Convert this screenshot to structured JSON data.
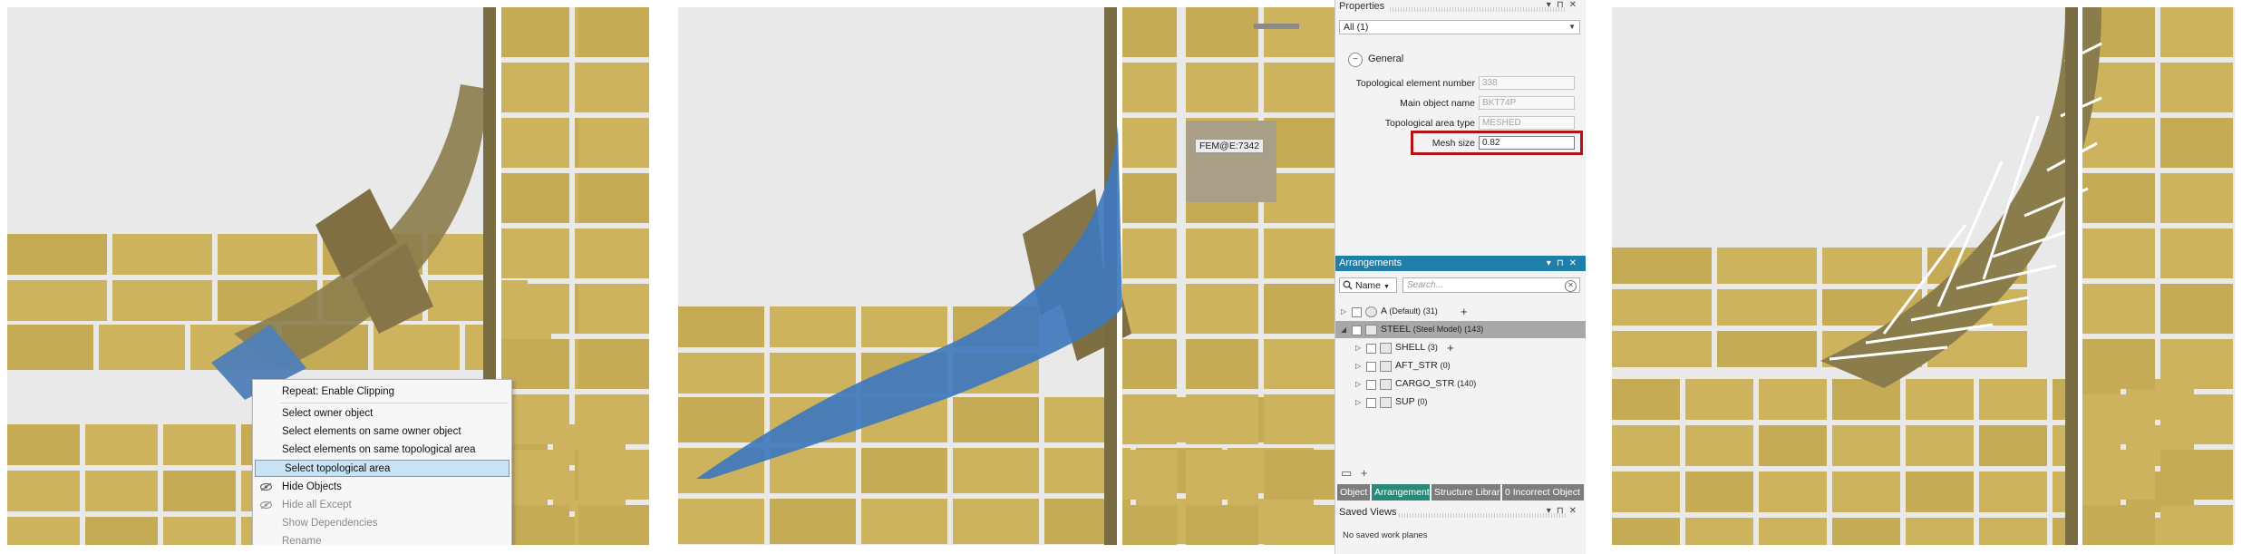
{
  "context_menu": {
    "items": [
      {
        "label": "Repeat: Enable Clipping",
        "state": "normal"
      },
      {
        "label": "Select owner object",
        "state": "normal"
      },
      {
        "label": "Select elements on same owner object",
        "state": "normal"
      },
      {
        "label": "Select elements on same topological area",
        "state": "normal"
      },
      {
        "label": "Select topological area",
        "state": "highlighted"
      },
      {
        "label": "Hide Objects",
        "state": "normal"
      },
      {
        "label": "Hide all Except",
        "state": "disabled"
      },
      {
        "label": "Show Dependencies",
        "state": "disabled"
      },
      {
        "label": "Rename",
        "state": "disabled"
      }
    ]
  },
  "viewport2": {
    "tooltip": "FEM@E:7342"
  },
  "properties": {
    "title": "Properties",
    "filter": "All (1)",
    "group": "General",
    "rows": [
      {
        "label": "Topological element number",
        "value": "338",
        "active": false
      },
      {
        "label": "Main object name",
        "value": "BKT74P",
        "active": false
      },
      {
        "label": "Topological area type",
        "value": "MESHED",
        "active": false
      },
      {
        "label": "Mesh size",
        "value": "0.82",
        "active": true
      }
    ]
  },
  "arrangements": {
    "title": "Arrangements",
    "search_by": "Name",
    "search_placeholder": "Search...",
    "tree": [
      {
        "name": "A",
        "suffix": "(Default)",
        "count": "(31)",
        "level": 0,
        "expanded": false,
        "plus": true,
        "highlighted": false
      },
      {
        "name": "STEEL",
        "suffix": "(Steel Model)",
        "count": "(143)",
        "level": 0,
        "expanded": true,
        "plus": false,
        "highlighted": true
      },
      {
        "name": "SHELL",
        "suffix": "",
        "count": "(3)",
        "level": 1,
        "expanded": false,
        "plus": true,
        "highlighted": false
      },
      {
        "name": "AFT_STR",
        "suffix": "",
        "count": "(0)",
        "level": 1,
        "expanded": false,
        "plus": false,
        "highlighted": false
      },
      {
        "name": "CARGO_STR",
        "suffix": "",
        "count": "(140)",
        "level": 1,
        "expanded": false,
        "plus": false,
        "highlighted": false
      },
      {
        "name": "SUP",
        "suffix": "",
        "count": "(0)",
        "level": 1,
        "expanded": false,
        "plus": false,
        "highlighted": false
      }
    ]
  },
  "tabs": [
    {
      "label": "Object",
      "active": false
    },
    {
      "label": "Arrangement",
      "active": true
    },
    {
      "label": "Structure Librar",
      "active": false
    },
    {
      "label": "0 Incorrect Object",
      "active": false
    }
  ],
  "saved_views": {
    "title": "Saved Views",
    "empty_text": "No saved work planes"
  },
  "colors": {
    "plate": "#cdb35e",
    "plate_dark": "#8a7a4a",
    "selected": "#4a7fb8",
    "highlight_box": "#b31217",
    "arr_header": "#1f7fa8",
    "tab_active": "#2a8a7a"
  }
}
